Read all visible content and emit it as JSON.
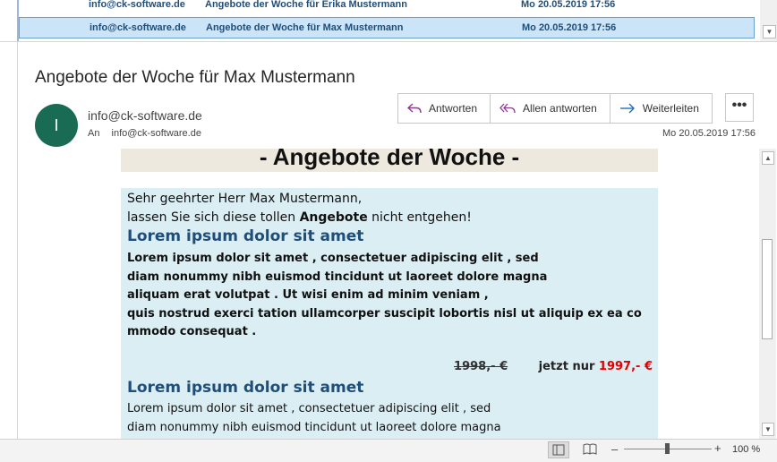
{
  "message_list": {
    "rows": [
      {
        "from": "info@ck-software.de",
        "subject": "Angebote der Woche für Erika Mustermann",
        "date": "Mo 20.05.2019 17:56"
      },
      {
        "from": "info@ck-software.de",
        "subject": "Angebote der Woche für Max Mustermann",
        "date": "Mo 20.05.2019 17:56"
      }
    ]
  },
  "reading_pane": {
    "subject": "Angebote der Woche für Max Mustermann",
    "avatar_initial": "I",
    "avatar_color": "#1a6b54",
    "sender": "info@ck-software.de",
    "to_label": "An",
    "to_value": "info@ck-software.de",
    "date": "Mo 20.05.2019 17:56",
    "actions": {
      "reply": "Antworten",
      "reply_all": "Allen antworten",
      "forward": "Weiterleiten",
      "more": "•••"
    }
  },
  "email_body": {
    "banner": "- Angebote der Woche -",
    "greeting_line1": "Sehr geehrter Herr Max Mustermann,",
    "greeting_line2_pre": "lassen Sie sich diese tollen ",
    "greeting_line2_bold": "Angebote",
    "greeting_line2_post": " nicht entgehen!",
    "offer1": {
      "heading": "Lorem ipsum dolor sit amet",
      "lines": [
        "Lorem  ipsum  dolor  sit  amet , consectetuer  adipiscing  elit , sed",
        "diam  nonummy  nibh  euismod  tincidunt  ut  laoreet  dolore magna",
        "aliquam  erat  volutpat . Ut  wisi  enim ad minim veniam ,",
        "quis  nostrud  exerci  tation  ullamcorper  suscipit  lobortis  nisl  ut  aliquip ex ea co",
        "mmodo consequat ."
      ],
      "old_price": "1998,- €",
      "new_price_label": "jetzt nur",
      "new_price": "1997,- €"
    },
    "offer2": {
      "heading": "Lorem  ipsum  dolor  sit  amet",
      "lines": [
        "Lorem  ipsum  dolor  sit  amet , consectetuer  adipiscing  elit , sed",
        "diam  nonummy  nibh  euismod  tincidunt  ut  laoreet  dolore magna"
      ]
    }
  },
  "status_bar": {
    "zoom_minus": "–",
    "zoom_plus": "+",
    "zoom_level": "100 %"
  },
  "colors": {
    "accent": "#1f4e79",
    "selected_row": "#cce4f7",
    "price_red": "#e00000",
    "content_bg": "#dbeef4"
  }
}
